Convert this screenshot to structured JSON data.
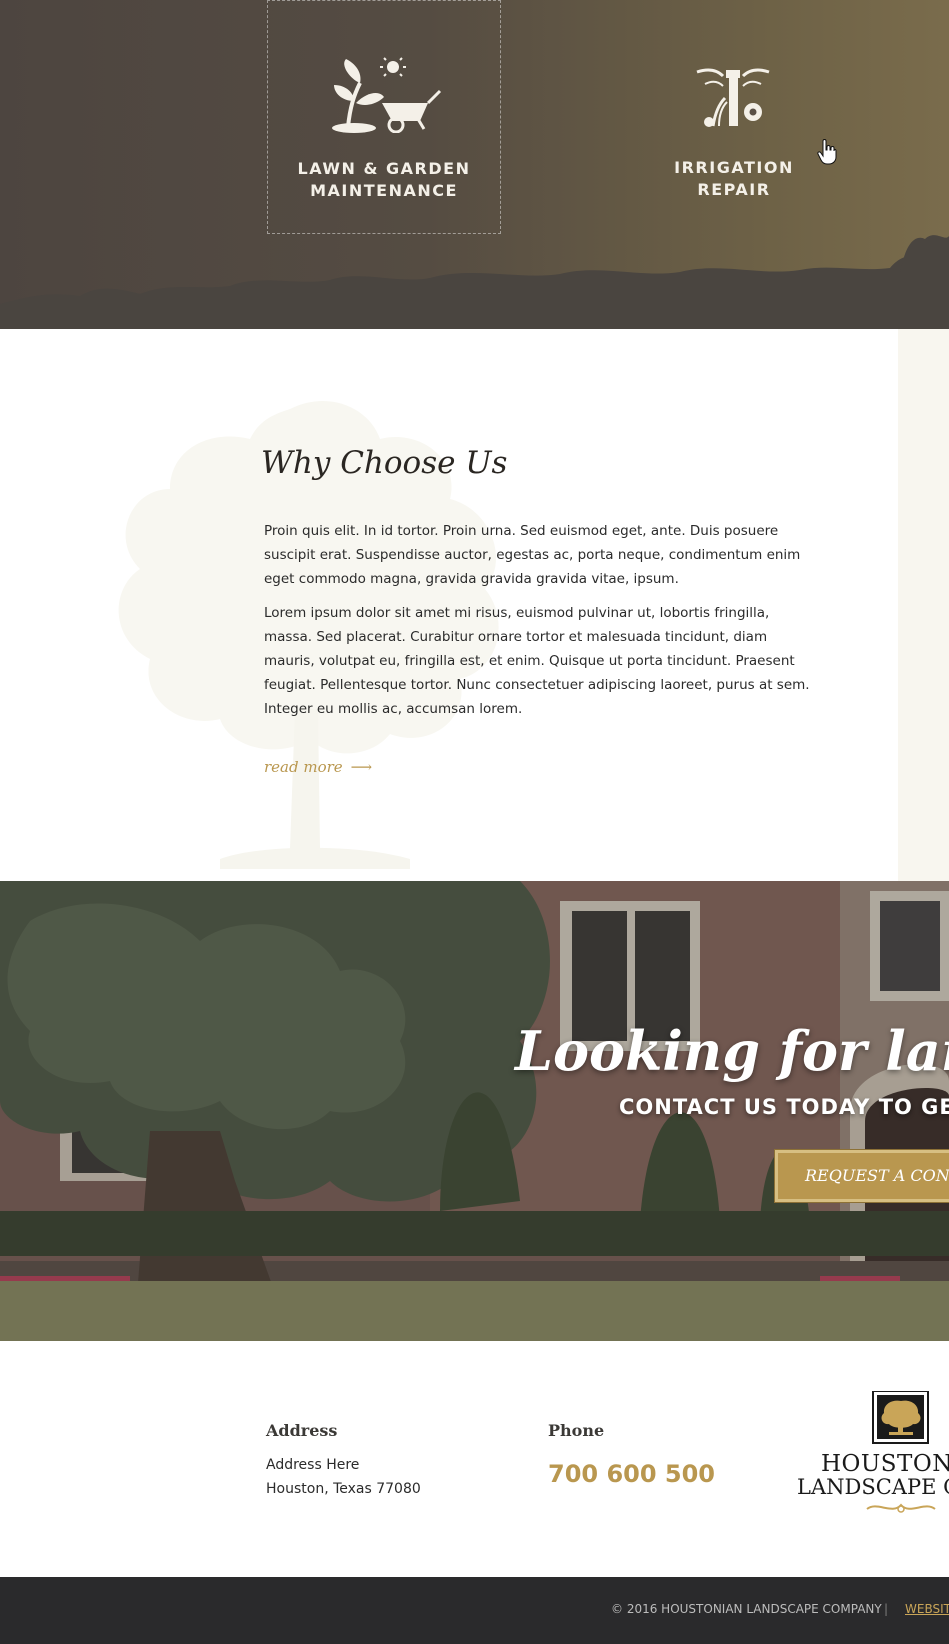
{
  "services": [
    {
      "label": "LAWN & GARDEN\nMAINTENANCE",
      "icon": "garden-wheelbarrow-icon"
    },
    {
      "label": "IRRIGATION\nREPAIR",
      "icon": "sprinkler-icon"
    }
  ],
  "why_choose_us": {
    "title": "Why Choose Us",
    "paragraph_1": "Proin quis elit. In id tortor. Proin urna. Sed euismod eget, ante. Duis posuere suscipit erat. Suspendisse auctor, egestas ac, porta neque, condimentum enim eget commodo magna, gravida gravida gravida vitae, ipsum.",
    "paragraph_2": "Lorem ipsum dolor sit amet mi risus, euismod pulvinar ut, lobortis fringilla, massa. Sed placerat. Curabitur ornare tortor et malesuada tincidunt, diam mauris, volutpat eu, fringilla est, et enim. Quisque ut porta tincidunt. Praesent feugiat. Pellentesque tortor.  Nunc consectetuer adipiscing laoreet, purus at sem. Integer eu mollis ac, accumsan lorem.",
    "read_more": "read more",
    "read_more_arrow": "⟶"
  },
  "hero": {
    "headline": "Looking for landsc",
    "subline": "CONTACT US TODAY TO GE",
    "cta_label": "REQUEST A CONSULT"
  },
  "contact": {
    "address_title": "Address",
    "address_line_1": "Address Here",
    "address_line_2": "Houston, Texas 77080",
    "phone_title": "Phone",
    "phone_number": "700 600 500",
    "logo_line_1": "HOUSTONIA",
    "logo_line_2": "LANDSCAPE COM"
  },
  "footer": {
    "copyright": "© 2016 HOUSTONIAN LANDSCAPE COMPANY",
    "separator": "|",
    "website_link": "WEBSIT"
  },
  "colors": {
    "accent_gold": "#b9974f",
    "services_bg": "#554c42",
    "footer_bg": "#2a2a2c"
  }
}
